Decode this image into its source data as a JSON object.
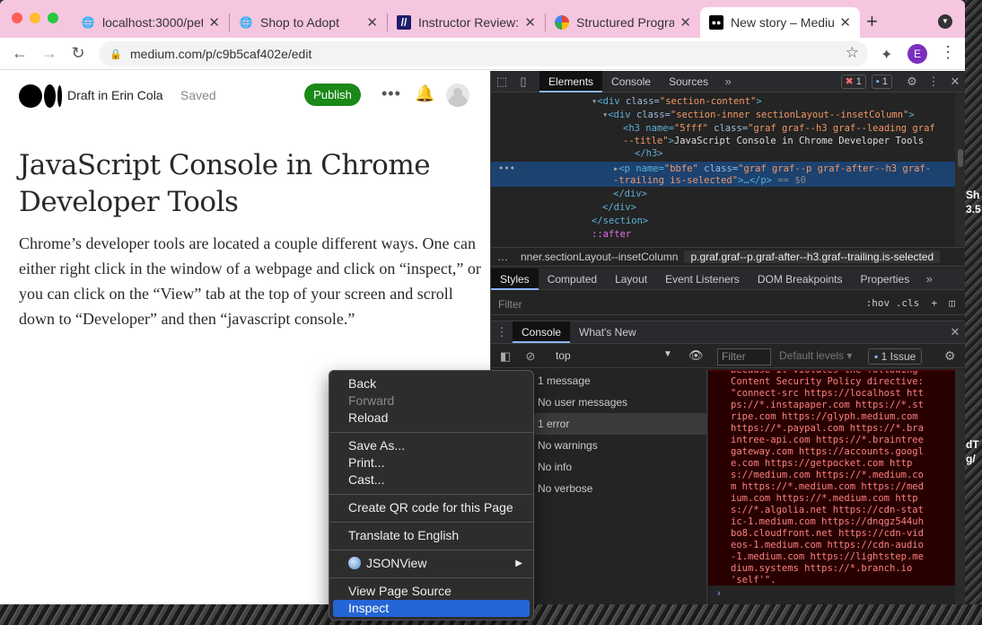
{
  "browser": {
    "tabs": [
      {
        "label": "localhost:3000/pet",
        "icon": "globe-icon"
      },
      {
        "label": "Shop to Adopt",
        "icon": "globe-icon"
      },
      {
        "label": "Instructor Review: I",
        "icon": "slash-logo-icon"
      },
      {
        "label": "Structured Program",
        "icon": "google-logo-icon"
      },
      {
        "label": "New story – Medium",
        "icon": "medium-logo-icon"
      }
    ],
    "url": "medium.com/p/c9b5caf402e/edit",
    "profile_initial": "E",
    "accent": "#f6c6e0"
  },
  "medium": {
    "draft_label": "Draft in Erin Cola",
    "saved_label": "Saved",
    "publish_label": "Publish",
    "title": "JavaScript Console in Chrome Developer Tools",
    "body": "Chrome’s developer tools are located a couple different ways. One can either right click in the window of a webpage and click on “inspect,” or you can click on the “View” tab at the top of your screen and scroll down to “Developer” and then “javascript console.”",
    "publish_color": "#1a8917"
  },
  "devtools": {
    "main_tabs": [
      "Elements",
      "Console",
      "Sources"
    ],
    "error_count": "1",
    "message_count": "1",
    "dom": {
      "line1_tag": "<div ",
      "line1_attr": "class=",
      "line1_val": "\"section-content\"",
      "line1_end": ">",
      "line2_tag": "<div ",
      "line2_attr": "class=",
      "line2_val": "\"section-inner sectionLayout--insetColumn\"",
      "line2_end": ">",
      "line3a": "<h3 name=",
      "line3a_val": "\"5fff\"",
      "line3a_attr": " class=",
      "line3a_val2": "\"graf graf--h3 graf--leading graf",
      "line3b_val": "--title\"",
      "line3b_tag": ">",
      "line3b_text": "JavaScript Console in Chrome Developer Tools",
      "line4": "</h3>",
      "line5a_tag": "<p name=",
      "line5a_val": "\"bbfe\"",
      "line5a_attr": " class=",
      "line5a_val2": "\"graf graf--p graf-after--h3 graf-",
      "line5b_val": "-trailing is-selected\"",
      "line5b_tag": ">…</p>",
      "line5b_eq": " == $0",
      "line6": "</div>",
      "line7": "</div>",
      "line8": "</section>",
      "line9": "::after"
    },
    "breadcrumbs": [
      "…",
      "nner.sectionLayout--insetColumn",
      "p.graf.graf--p.graf-after--h3.graf--trailing.is-selected"
    ],
    "styles_tabs": [
      "Styles",
      "Computed",
      "Layout",
      "Event Listeners",
      "DOM Breakpoints",
      "Properties"
    ],
    "styles_filter_placeholder": "Filter",
    "styles_controls": ":hov  .cls",
    "drawer_tabs": [
      "Console",
      "What's New"
    ],
    "console_context": "top",
    "console_filter_placeholder": "Filter",
    "levels_label": "Default levels ▾",
    "issues_label": "1 Issue",
    "sidebar_items": [
      "1 message",
      "No user messages",
      "1 error",
      "No warnings",
      "No info",
      "No verbose"
    ],
    "error_lines": [
      "because it violates the following",
      "Content Security Policy directive:",
      "\"connect-src https://localhost htt",
      "ps://*.instapaper.com https://*.st",
      "ripe.com https://glyph.medium.com",
      "https://*.paypal.com https://*.bra",
      "intree-api.com https://*.braintree",
      "gateway.com https://accounts.googl",
      "e.com https://getpocket.com http",
      "s://medium.com https://*.medium.co",
      "m https://*.medium.com https://med",
      "ium.com https://*.medium.com http",
      "s://*.algolia.net https://cdn-stat",
      "ic-1.medium.com https://dnqgz544uh",
      "bo8.cloudfront.net https://cdn-vid",
      "eos-1.medium.com https://cdn-audio",
      "-1.medium.com https://lightstep.me",
      "dium.systems https://*.branch.io",
      "'self'\"."
    ]
  },
  "context_menu": {
    "group1": [
      "Back",
      "Forward",
      "Reload"
    ],
    "group2": [
      "Save As...",
      "Print...",
      "Cast..."
    ],
    "group3": [
      "Create QR code for this Page"
    ],
    "group4": [
      "Translate to English"
    ],
    "group5": [
      "JSONView"
    ],
    "group6": [
      "View Page Source",
      "Inspect"
    ]
  },
  "desktop_peek": {
    "a": "Sh",
    "b": "3.5",
    "c": "dT",
    "d": "g/"
  }
}
